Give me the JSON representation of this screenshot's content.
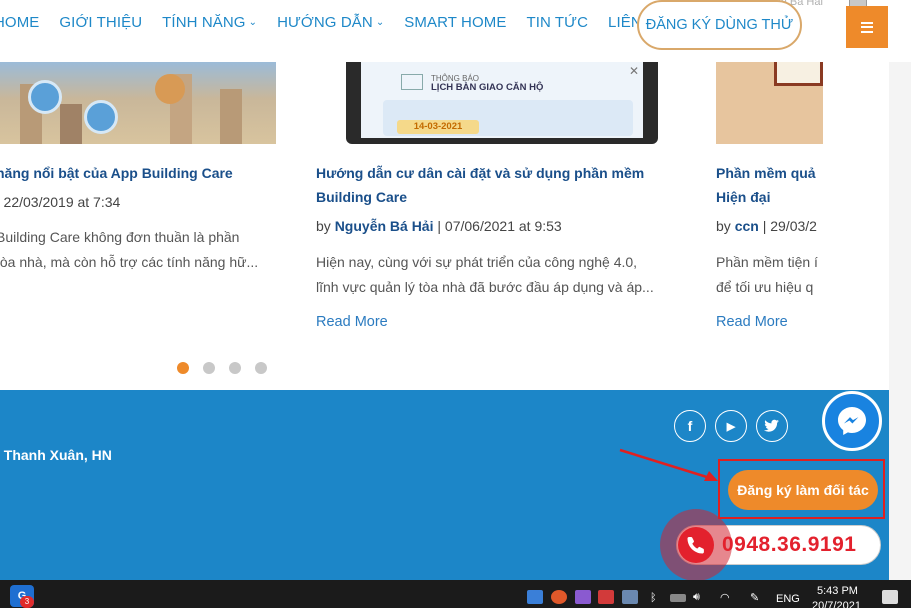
{
  "nav": {
    "items": [
      {
        "label": "HOME",
        "has_caret": false
      },
      {
        "label": "GIỚI THIỆU",
        "has_caret": false
      },
      {
        "label": "TÍNH NĂNG",
        "has_caret": true
      },
      {
        "label": "HƯỚNG DẪN",
        "has_caret": true
      },
      {
        "label": "SMART HOME",
        "has_caret": false
      },
      {
        "label": "TIN TỨC",
        "has_caret": false
      },
      {
        "label": "LIÊN HỆ",
        "has_caret": false
      }
    ],
    "cta_label": "ĐĂNG KÝ DÙNG THỬ",
    "howdy": "Howdy, Nguyễn Bá Hải",
    "menu_icon": "hamburger-icon"
  },
  "cards": [
    {
      "title": "năng nổi bật của App Building Care",
      "meta_date": "22/03/2019 at 7:34",
      "excerpt_lines": [
        "Building Care không đơn thuần là phần",
        "tòa nhà, mà còn hỗ trợ các tính năng hữ..."
      ]
    },
    {
      "title_lines": [
        "Hướng dẫn cư dân cài đặt và sử dụng phần mềm",
        "Building Care"
      ],
      "meta_by": "by",
      "author": "Nguyễn Bá Hải",
      "meta_date": "07/06/2021 at 9:53",
      "excerpt_lines": [
        "Hiện nay, cùng với sự phát triển của công nghệ 4.0,",
        "lĩnh vực quản lý tòa nhà đã bước đầu áp dụng và áp..."
      ],
      "read_more": "Read More",
      "image": {
        "small_label": "THÔNG BÁO",
        "title": "LỊCH BÀN GIAO CĂN HỘ",
        "date": "14-03-2021"
      }
    },
    {
      "title_lines": [
        "Phần mềm quả",
        "Hiện đại"
      ],
      "meta_by": "by",
      "author": "ccn",
      "meta_date": "29/03/2",
      "excerpt_lines": [
        "Phần mềm tiện í",
        "để tối ưu hiệu q"
      ],
      "read_more": "Read More"
    }
  ],
  "carousel": {
    "count": 4,
    "active": 0
  },
  "footer": {
    "address": ", Thanh Xuân, HN",
    "social": [
      {
        "name": "facebook-icon",
        "glyph": "f"
      },
      {
        "name": "youtube-icon",
        "glyph": "▶"
      },
      {
        "name": "twitter-icon",
        "glyph": "🐦"
      }
    ],
    "partner_button": "Đăng ký làm đối tác",
    "hotline": "0948.36.9191"
  },
  "taskbar": {
    "app_badge": "3",
    "language": "ENG",
    "time": "5:43 PM",
    "date": "20/7/2021"
  },
  "colors": {
    "brand_blue": "#1c86c8",
    "accent_orange": "#ee8a2a",
    "hotline_red": "#e3212d",
    "annotation_red": "#e02020"
  }
}
